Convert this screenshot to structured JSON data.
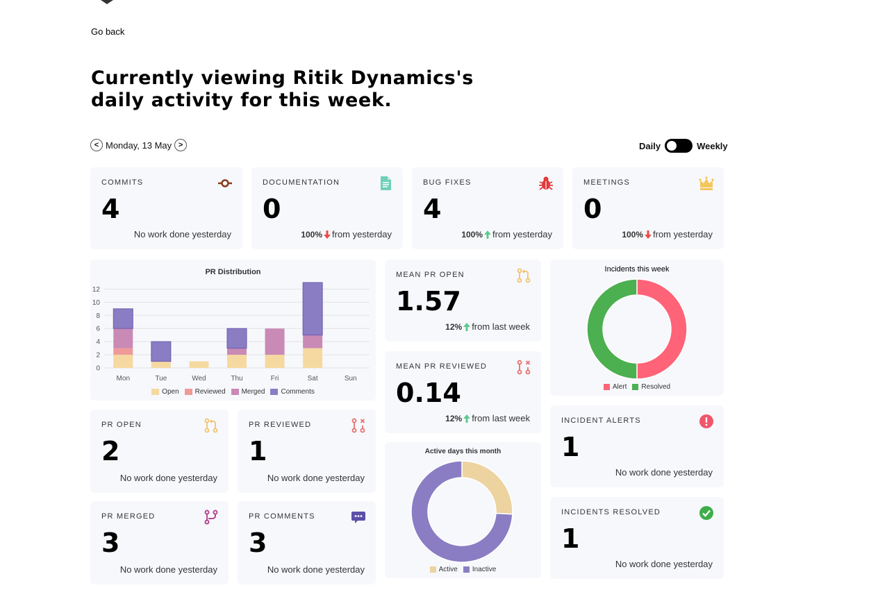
{
  "nav": {
    "go_back": "Go back"
  },
  "headline": "Currently viewing Ritik Dynamics's daily activity for this week.",
  "date_picker": {
    "prev": "<",
    "date": "Monday, 13 May",
    "next": ">"
  },
  "view_toggle": {
    "left": "Daily",
    "right": "Weekly",
    "state": "daily"
  },
  "stats": {
    "commits": {
      "title": "COMMITS",
      "value": "4",
      "note": "No work done yesterday",
      "icon": "commit-icon",
      "color": "#8b3a1a"
    },
    "documentation": {
      "title": "DOCUMENTATION",
      "value": "0",
      "pct": "100%",
      "note": "from yesterday",
      "trend": "down",
      "icon": "document-icon",
      "color": "#6fcfb8"
    },
    "bug_fixes": {
      "title": "BUG FIXES",
      "value": "4",
      "pct": "100%",
      "note": "from yesterday",
      "trend": "up",
      "icon": "bug-icon",
      "color": "#e23b3b"
    },
    "meetings": {
      "title": "MEETINGS",
      "value": "0",
      "pct": "100%",
      "note": "from yesterday",
      "trend": "down",
      "icon": "crown-icon",
      "color": "#f5c65a"
    },
    "mean_pr_open": {
      "title": "MEAN PR OPEN",
      "value": "1.57",
      "pct": "12%",
      "note": "from last week",
      "trend": "up",
      "icon": "pull-request-icon",
      "color": "#f2c26b"
    },
    "mean_pr_reviewed": {
      "title": "MEAN PR REVIEWED",
      "value": "0.14",
      "pct": "12%",
      "note": "from last week",
      "trend": "up",
      "icon": "pr-closed-icon",
      "color": "#e76f6f"
    },
    "pr_open": {
      "title": "PR OPEN",
      "value": "2",
      "note": "No work done yesterday",
      "icon": "pull-request-icon",
      "color": "#f2c26b"
    },
    "pr_reviewed": {
      "title": "PR REVIEWED",
      "value": "1",
      "note": "No work done yesterday",
      "icon": "pr-closed-icon",
      "color": "#e76f6f"
    },
    "pr_merged": {
      "title": "PR MERGED",
      "value": "3",
      "note": "No work done yesterday",
      "icon": "merge-icon",
      "color": "#b5488f"
    },
    "pr_comments": {
      "title": "PR COMMENTS",
      "value": "3",
      "note": "No work done yesterday",
      "icon": "comment-icon",
      "color": "#5b4fa8"
    },
    "incident_alerts": {
      "title": "INCIDENT ALERTS",
      "value": "1",
      "note": "No work done yesterday",
      "icon": "alert-icon",
      "color": "#f0566b"
    },
    "incidents_resolved": {
      "title": "INCIDENTS RESOLVED",
      "value": "1",
      "note": "No work done yesterday",
      "icon": "check-icon",
      "color": "#3fae49"
    }
  },
  "colors": {
    "up": "#5fc98f",
    "down": "#e94b4b"
  },
  "chart_data": [
    {
      "type": "bar",
      "stacked": true,
      "title": "PR Distribution",
      "categories": [
        "Mon",
        "Tue",
        "Wed",
        "Thu",
        "Fri",
        "Sat",
        "Sun"
      ],
      "ylim": [
        0,
        13
      ],
      "yticks": [
        0,
        2,
        4,
        6,
        8,
        10,
        12
      ],
      "grid": true,
      "legend": "bottom",
      "series": [
        {
          "name": "Open",
          "values": [
            2,
            1,
            1,
            2,
            2,
            3,
            0
          ],
          "color": "#f5d9a0"
        },
        {
          "name": "Reviewed",
          "values": [
            1,
            0,
            0,
            0,
            0,
            0,
            0
          ],
          "color": "#ef9999"
        },
        {
          "name": "Merged",
          "values": [
            3,
            0,
            0,
            1,
            4,
            2,
            0
          ],
          "color": "#c98ab5"
        },
        {
          "name": "Comments",
          "values": [
            3,
            3,
            0,
            3,
            0,
            8,
            0
          ],
          "color": "#8a7dc4"
        }
      ]
    },
    {
      "type": "pie",
      "donut": true,
      "title": "Incidents this week",
      "legend": "bottom",
      "labels": [
        "Alert",
        "Resolved"
      ],
      "values": [
        1,
        1
      ],
      "colors": [
        "#ff6378",
        "#4caf50"
      ]
    },
    {
      "type": "pie",
      "donut": true,
      "title": "Active days this month",
      "legend": "bottom",
      "labels": [
        "Active",
        "Inactive"
      ],
      "values": [
        8,
        23
      ],
      "colors": [
        "#ecd3a0",
        "#8a7dc4"
      ]
    }
  ]
}
